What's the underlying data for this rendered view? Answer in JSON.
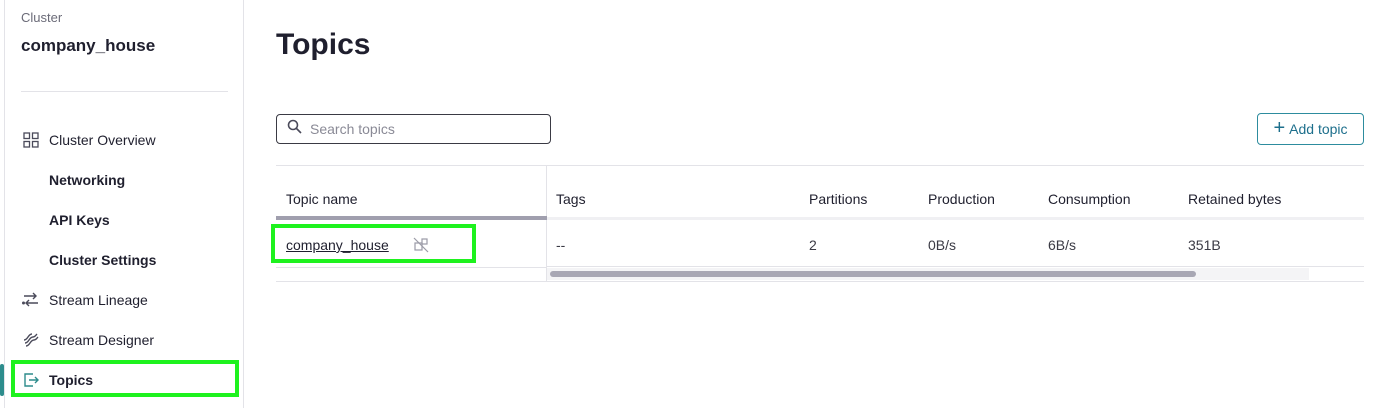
{
  "sidebar": {
    "cluster_label": "Cluster",
    "cluster_name": "company_house",
    "items": [
      {
        "label": "Cluster Overview",
        "icon": "grid-icon"
      },
      {
        "label": "Networking"
      },
      {
        "label": "API Keys"
      },
      {
        "label": "Cluster Settings"
      },
      {
        "label": "Stream Lineage",
        "icon": "lineage-icon"
      },
      {
        "label": "Stream Designer",
        "icon": "designer-icon"
      },
      {
        "label": "Topics",
        "icon": "topics-icon",
        "active": true
      }
    ]
  },
  "main": {
    "title": "Topics",
    "search_placeholder": "Search topics",
    "add_button": "Add topic"
  },
  "table": {
    "columns": [
      "Topic name",
      "Tags",
      "Partitions",
      "Production",
      "Consumption",
      "Retained bytes"
    ],
    "rows": [
      {
        "name": "company_house",
        "tags": "--",
        "partitions": "2",
        "production": "0B/s",
        "consumption": "6B/s",
        "retained": "351B"
      }
    ]
  },
  "colors": {
    "accent": "#2d8c8c",
    "highlight": "#1ef21e",
    "button_text": "#1d6f8c"
  }
}
